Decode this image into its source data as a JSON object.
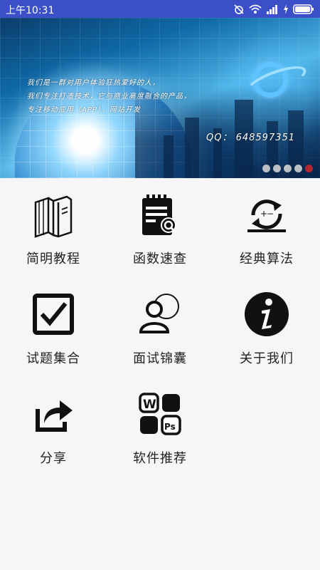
{
  "status_bar": {
    "time": "上午10:31"
  },
  "banner": {
    "lines": [
      "我们是一群对用户体验狂热爱好的人，",
      "我们专注打造技术，它与商业高度融合的产品，",
      "专注移动应用（APP），网站开发"
    ],
    "qq": "QQ： 648597351",
    "dots": [
      false,
      false,
      false,
      false,
      true
    ]
  },
  "menu": [
    {
      "id": "tutorial",
      "label": "简明教程",
      "icon": "books-icon"
    },
    {
      "id": "function",
      "label": "函数速查",
      "icon": "calendar-search-icon"
    },
    {
      "id": "algorithm",
      "label": "经典算法",
      "icon": "refresh-arithmetic-icon"
    },
    {
      "id": "questions",
      "label": "试题集合",
      "icon": "checkbox-icon"
    },
    {
      "id": "interview",
      "label": "面试锦囊",
      "icon": "user-chat-icon"
    },
    {
      "id": "about",
      "label": "关于我们",
      "icon": "info-icon"
    },
    {
      "id": "share",
      "label": "分享",
      "icon": "share-icon"
    },
    {
      "id": "software",
      "label": "软件推荐",
      "icon": "apps-icon"
    }
  ]
}
